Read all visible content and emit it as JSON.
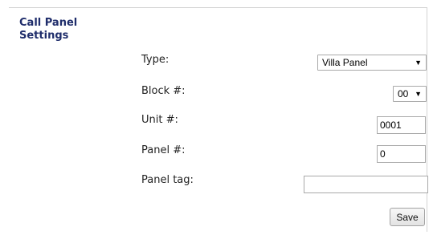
{
  "section": {
    "title": "Call Panel Settings"
  },
  "fields": {
    "type": {
      "label": "Type:",
      "value": "Villa Panel"
    },
    "block": {
      "label": "Block #:",
      "value": "00"
    },
    "unit": {
      "label": "Unit #:",
      "value": "0001"
    },
    "panel": {
      "label": "Panel #:",
      "value": "0"
    },
    "panel_tag": {
      "label": "Panel tag:",
      "value": ""
    }
  },
  "actions": {
    "save_label": "Save"
  }
}
